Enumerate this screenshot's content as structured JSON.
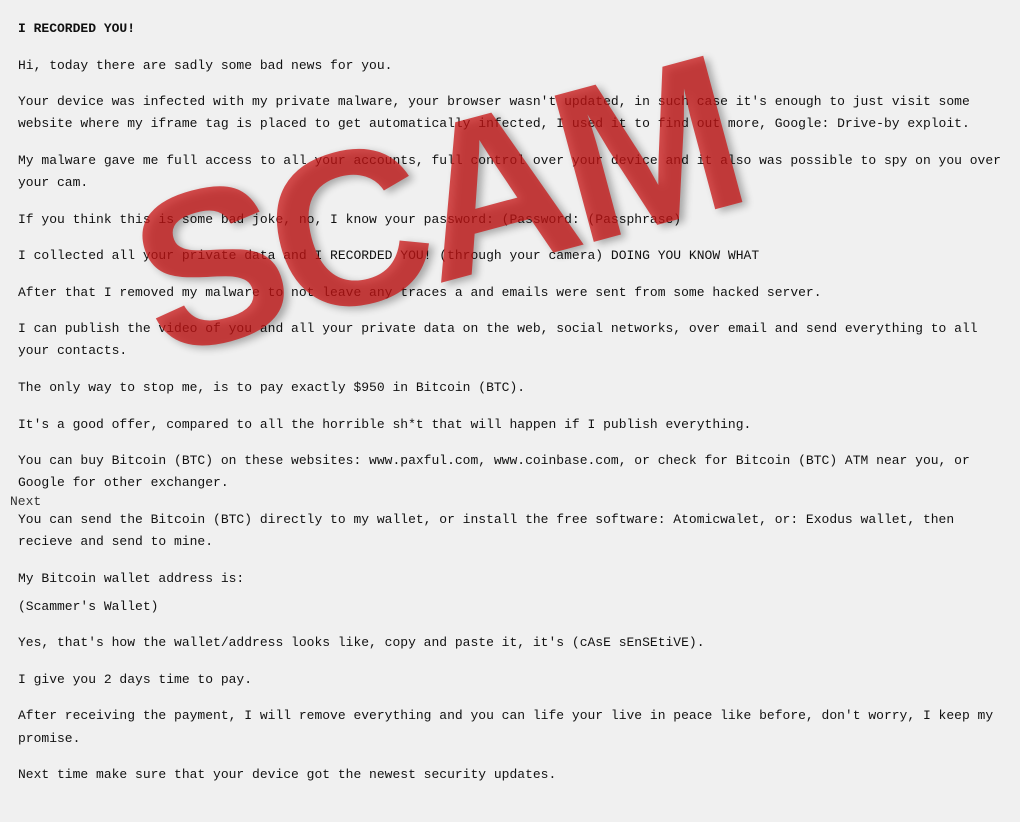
{
  "watermark": "SCAM",
  "nav": {
    "next_label": "Next"
  },
  "paragraphs": [
    "I RECORDED YOU!",
    "",
    "Hi, today there are sadly some bad news for you.",
    "",
    "Your device was infected with my private malware, your browser wasn't updated, in such case it's enough to just visit some website where my iframe tag is placed to get automatically infected, I used it to find out more, Google: Drive-by exploit.",
    "",
    "My malware gave me full access to all your accounts, full control over your device and it also was possible to spy on you over your cam.",
    "",
    "If you think this is some bad joke, no, I know your password: (Password: (Passphrase)",
    "",
    "I collected all your private data and I RECORDED YOU! (through your camera) DOING YOU KNOW WHAT",
    "",
    "After that I removed my malware to not leave any traces a and emails were sent from some hacked server.",
    "",
    "I can publish the video of you and all your private data on the web, social networks, over email and send everything to all your contacts.",
    "",
    "The only way to stop me, is to pay exactly $950 in Bitcoin (BTC).",
    "",
    "It's a good offer, compared to all the horrible sh*t that will happen if I publish everything.",
    "",
    "You can buy Bitcoin (BTC) on these websites: www.paxful.com, www.coinbase.com, or check for Bitcoin (BTC) ATM near you, or Google for other exchanger.",
    "",
    "You can send the Bitcoin (BTC) directly to my wallet, or install the free software: Atomicwalet, or: Exodus wallet, then recieve and send to mine.",
    "",
    "My Bitcoin wallet address is:",
    "(Scammer's Wallet)",
    "",
    "Yes, that's how the wallet/address looks like, copy and paste it, it's (cAsE sEnSEtiVE).",
    "",
    "I give you 2 days time to pay.",
    "",
    "After receiving the payment, I will remove everything and you can life your live in peace like before, don't worry, I keep my promise.",
    "",
    "Next time make sure that your device got the newest security updates."
  ]
}
